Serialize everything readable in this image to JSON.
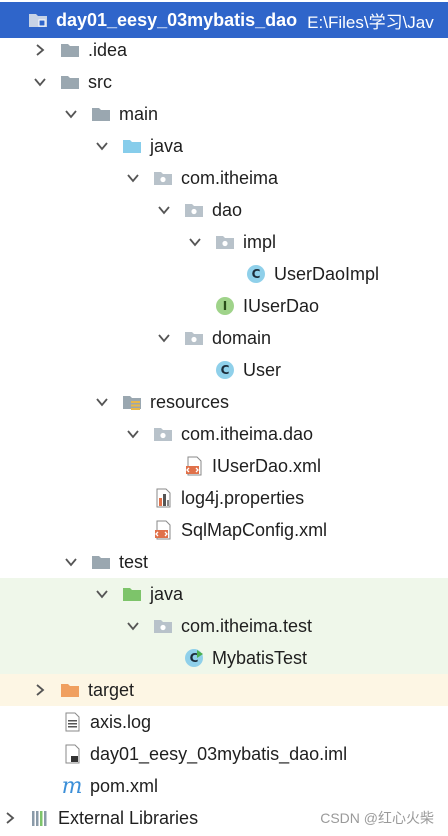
{
  "project": {
    "name": "day01_eesy_03mybatis_dao",
    "path": "E:\\Files\\学习\\Jav"
  },
  "tree": {
    "idea": ".idea",
    "src": "src",
    "main": "main",
    "java_main": "java",
    "pkg_itheima": "com.itheima",
    "dao": "dao",
    "impl": "impl",
    "user_dao_impl": "UserDaoImpl",
    "iuser_dao": "IUserDao",
    "domain": "domain",
    "user": "User",
    "resources": "resources",
    "pkg_res_dao": "com.itheima.dao",
    "iuser_dao_xml": "IUserDao.xml",
    "log4j": "log4j.properties",
    "sqlmap": "SqlMapConfig.xml",
    "test": "test",
    "java_test": "java",
    "pkg_test": "com.itheima.test",
    "mybatis_test": "MybatisTest",
    "target": "target",
    "axis_log": "axis.log",
    "iml": "day01_eesy_03mybatis_dao.iml",
    "pom": "pom.xml",
    "external": "External Libraries"
  },
  "badges": {
    "class": "C",
    "interface": "I"
  },
  "watermark": "CSDN @红心火柴",
  "colors": {
    "selection": "#2f65ca",
    "test_bg": "#eff7ea",
    "excluded_bg": "#fdf6e4",
    "folder": "#9aa7b0",
    "java_folder": "#87cdeb",
    "test_folder": "#7dc46a",
    "target_folder": "#f0a060"
  }
}
